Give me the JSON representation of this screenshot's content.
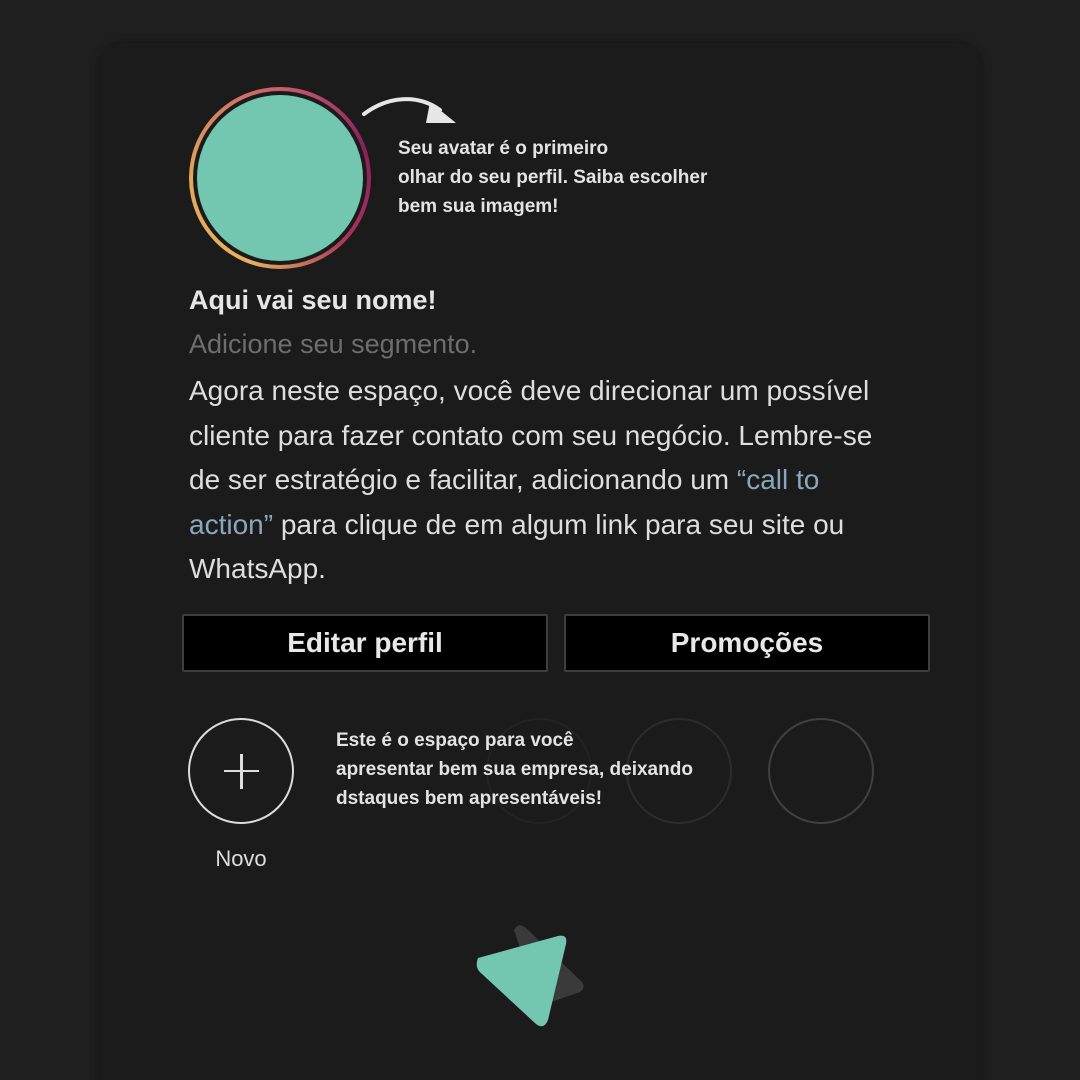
{
  "avatar": {
    "color": "#73c7b1",
    "ring_colors": [
      "#e9b15c",
      "#c2566d",
      "#8a1f5e"
    ],
    "hint_icon": "curved-arrow-icon",
    "hint": "Seu avatar é o primeiro\nolhar do seu perfil. Saiba escolher\nbem sua imagem!"
  },
  "profile": {
    "name": "Aqui vai seu nome!",
    "segment": "Adicione seu segmento.",
    "bio_before": "Agora neste espaço, você deve direcionar um possível cliente para fazer contato com seu negócio. Lembre-se de ser estratégio e facilitar, adicionando um ",
    "bio_cta": "“call to action”",
    "bio_after": " para clique de em algum link para seu site ou WhatsApp."
  },
  "buttons": {
    "edit_profile": "Editar perfil",
    "promotions": "Promoções"
  },
  "highlights": {
    "new_label": "Novo",
    "new_icon": "plus-icon",
    "hint": "Este é o espaço para você\napresentar bem sua empresa, deixando\ndstaques bem apresentáveis!"
  },
  "logo": {
    "icon": "triangle-logo-icon",
    "colors": [
      "#73c7b1",
      "#3a3a3a"
    ]
  }
}
